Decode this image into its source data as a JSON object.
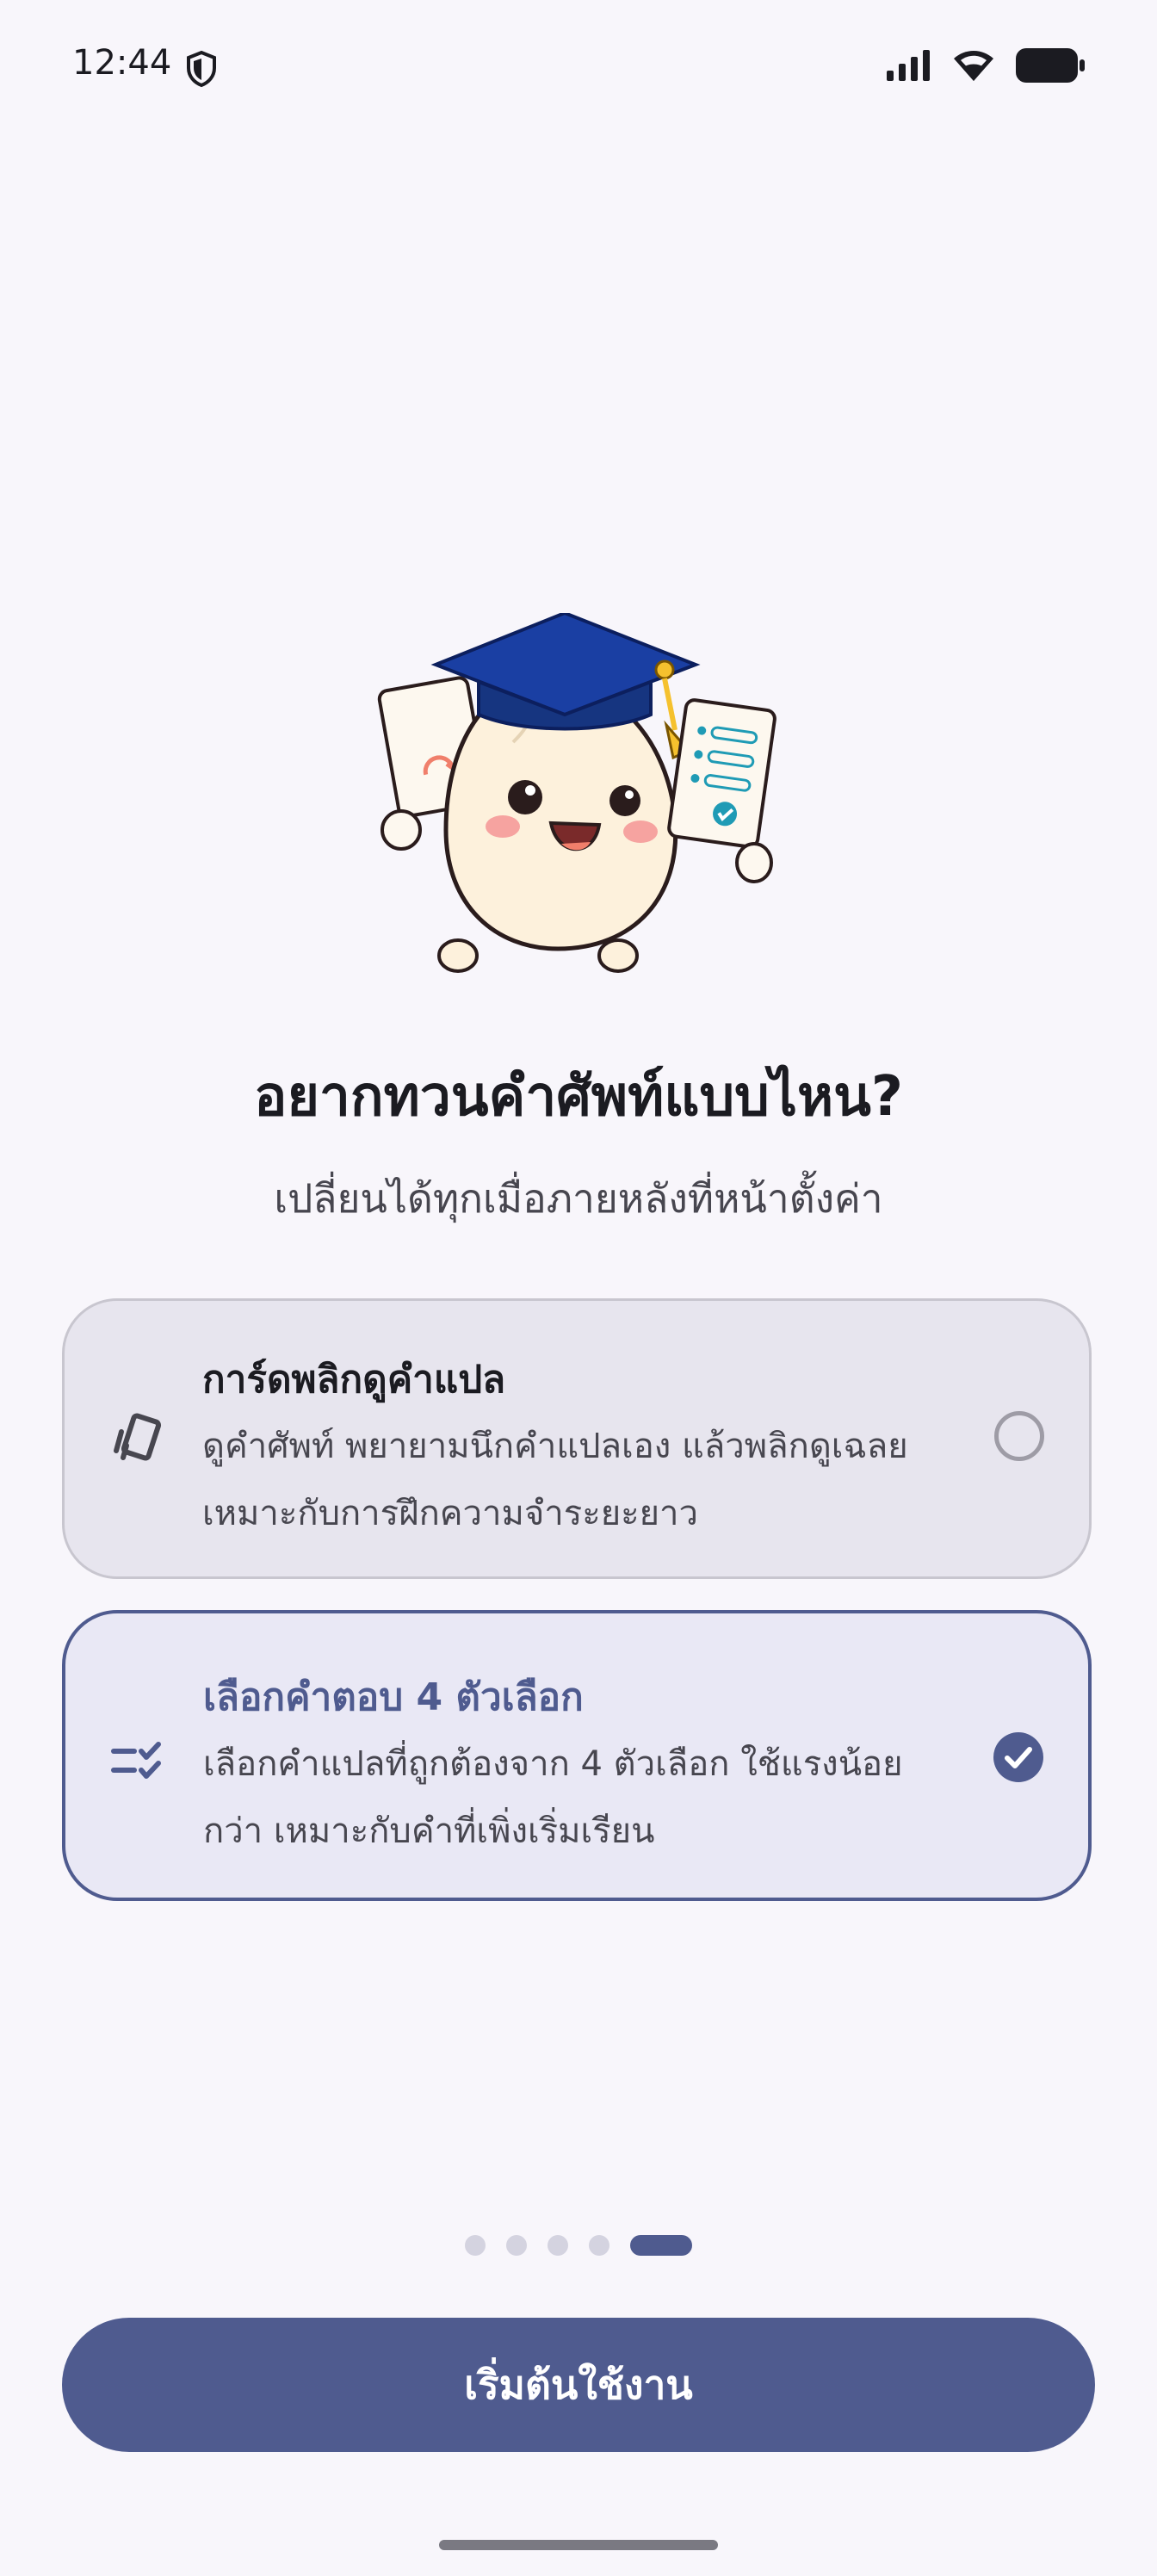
{
  "status_bar": {
    "time": "12:44",
    "icons": [
      "shield-icon",
      "signal-icon",
      "wifi-icon",
      "battery-icon"
    ]
  },
  "onboarding": {
    "mascot": "graduate-bun-mascot",
    "title": "อยากทวนคำศัพท์แบบไหน?",
    "subtitle": "เปลี่ยนได้ทุกเมื่อภายหลังที่หน้าตั้งค่า"
  },
  "options": [
    {
      "icon": "flip-cards-icon",
      "title": "การ์ดพลิกดูคำแปล",
      "description_line1": "ดูคำศัพท์ พยายามนึกคำแปลเอง แล้วพลิกดูเฉลย",
      "description_line2": "เหมาะกับการฝึกความจำระยะยาว",
      "selected": false
    },
    {
      "icon": "checklist-icon",
      "title": "เลือกคำตอบ 4 ตัวเลือก",
      "description_line1": "เลือกคำแปลที่ถูกต้องจาก 4 ตัวเลือก ใช้แรงน้อย",
      "description_line2": "กว่า เหมาะกับคำที่เพิ่งเริ่มเรียน",
      "selected": true
    }
  ],
  "pagination": {
    "total": 5,
    "current": 5
  },
  "start_button_label": "เริ่มต้นใช้งาน",
  "colors": {
    "primary": "#4f5b8f",
    "background": "#f8f6fb",
    "card_unselected": "#e7e5ee",
    "card_selected": "#e9e8f5"
  }
}
